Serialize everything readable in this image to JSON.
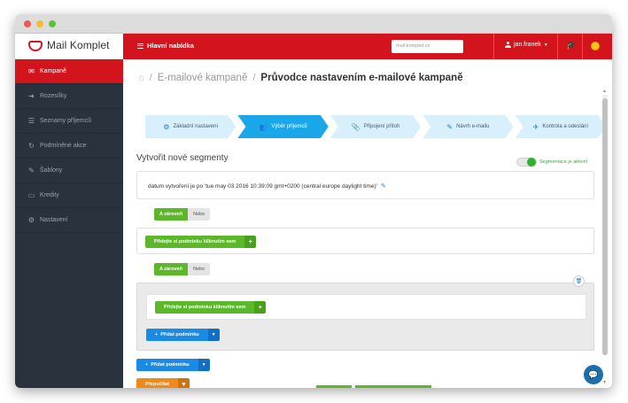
{
  "brand": {
    "name": "Mail Komplet",
    "accent": "#d4141c"
  },
  "topbar": {
    "menu_label": "Hlavní nabídka",
    "search_placeholder": "mail-komplet.cz",
    "user_name": "jan.franek"
  },
  "sidebar": {
    "items": [
      {
        "label": "Kampaně",
        "icon": "envelope-icon",
        "active": true
      },
      {
        "label": "Rozesílky",
        "icon": "sign-in-icon"
      },
      {
        "label": "Seznamy příjemců",
        "icon": "list-icon"
      },
      {
        "label": "Podmíněné akce",
        "icon": "refresh-icon"
      },
      {
        "label": "Šablony",
        "icon": "edit-icon"
      },
      {
        "label": "Kredity",
        "icon": "credit-card-icon"
      },
      {
        "label": "Nastavení",
        "icon": "gears-icon"
      }
    ]
  },
  "breadcrumb": {
    "parent": "E-mailové kampaně",
    "current": "Průvodce nastavením e-mailové kampaně"
  },
  "wizard": {
    "steps": [
      {
        "label": "Základní nastavení",
        "icon": "gears-icon"
      },
      {
        "label": "Výběr příjemců",
        "icon": "users-icon",
        "active": true
      },
      {
        "label": "Připojení příloh",
        "icon": "paperclip-icon"
      },
      {
        "label": "Návrh e-mailu",
        "icon": "pencil-icon"
      },
      {
        "label": "Kontrola a odeslání",
        "icon": "paper-plane-icon"
      }
    ]
  },
  "segments": {
    "title": "Vytvořit nové segmenty",
    "toggle_label": "Segmentace je aktivní",
    "condition_text": "datum vytvoření je po 'tue may 03 2016 10:39:09 gmt+0200 (central europe daylight time)'",
    "and_label": "A zároveň",
    "or_label": "Nebo",
    "add_condition_click": "Přidejte si podmínku kliknutím sem",
    "add_condition": "Přidat podmínku",
    "recalculate": "Přepočítat"
  }
}
